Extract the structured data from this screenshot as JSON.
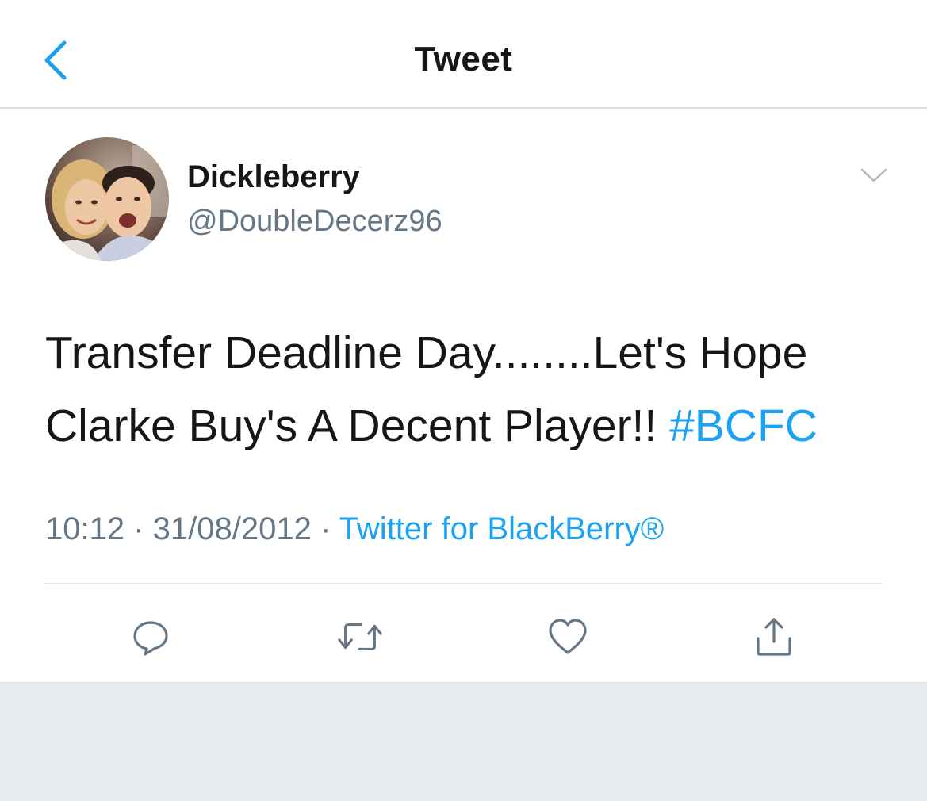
{
  "header": {
    "title": "Tweet",
    "back_icon": "chevron-left-icon"
  },
  "tweet": {
    "display_name": "Dickleberry",
    "handle": "@DoubleDecerz96",
    "text_line1": "Transfer Deadline Day........Let's Hope",
    "text_line2": "Clarke Buy's A Decent Player!! ",
    "hashtag": "#BCFC",
    "time": "10:12",
    "separator": " · ",
    "date": "31/08/2012",
    "source": "Twitter for BlackBerry®"
  },
  "actions": [
    {
      "name": "reply",
      "icon": "reply-icon"
    },
    {
      "name": "retweet",
      "icon": "retweet-icon"
    },
    {
      "name": "like",
      "icon": "heart-icon"
    },
    {
      "name": "share",
      "icon": "share-icon"
    }
  ],
  "colors": {
    "accent": "#1da1f2",
    "secondary_text": "#657786",
    "primary_text": "#14171a",
    "background": "#e6ecf0"
  }
}
